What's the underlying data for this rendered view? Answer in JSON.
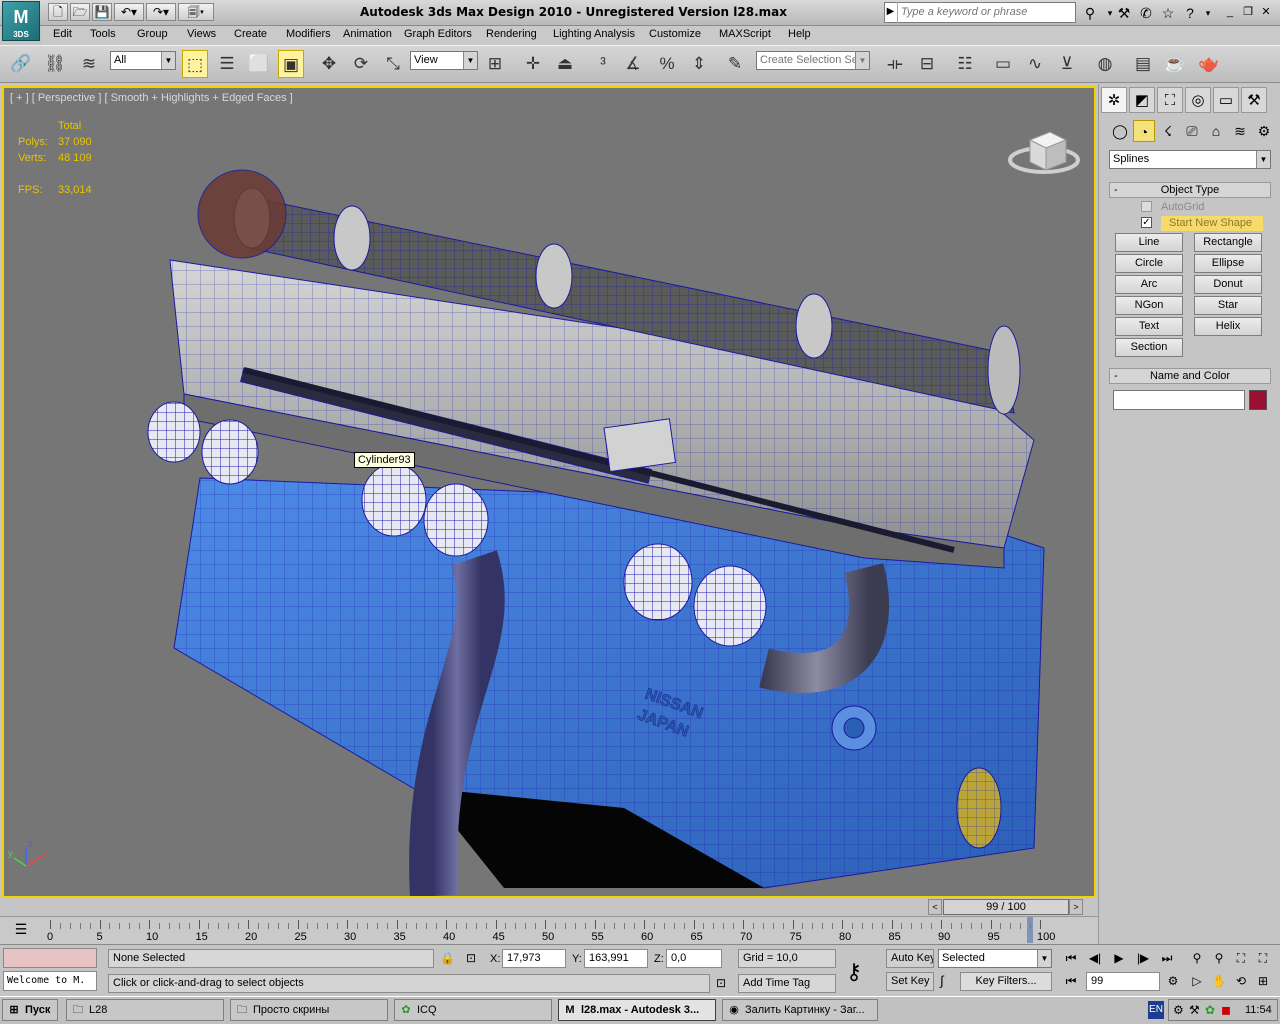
{
  "app": {
    "logo_text": "M",
    "logo_sub": "3DS",
    "title": "Autodesk 3ds Max Design 2010  -  Unregistered Version    l28.max"
  },
  "search": {
    "placeholder": "Type a keyword or phrase"
  },
  "menu": [
    "Edit",
    "Tools",
    "Group",
    "Views",
    "Create",
    "Modifiers",
    "Animation",
    "Graph Editors",
    "Rendering",
    "Lighting Analysis",
    "Customize",
    "MAXScript",
    "Help"
  ],
  "toolbar": {
    "selection_filter": "All",
    "ref_coord": "View",
    "named_selection_placeholder": "Create Selection Se"
  },
  "viewport": {
    "label": "[ + ] [ Perspective ] [ Smooth + Highlights + Edged Faces ]",
    "stats": {
      "total_label": "Total",
      "polys_label": "Polys:",
      "polys_value": "37 090",
      "verts_label": "Verts:",
      "verts_value": "48 109",
      "fps_label": "FPS:",
      "fps_value": "33,014"
    },
    "engraving": [
      "NISSAN",
      "JAPAN"
    ],
    "tooltip": "Cylinder93",
    "axis": {
      "x": "x",
      "y": "y",
      "z": "z"
    }
  },
  "command_panel": {
    "category": "Splines",
    "object_type_title": "Object Type",
    "autogrid_label": "AutoGrid",
    "start_new_shape_label": "Start New Shape",
    "start_new_shape_checked": true,
    "buttons": [
      "Line",
      "Rectangle",
      "Circle",
      "Ellipse",
      "Arc",
      "Donut",
      "NGon",
      "Star",
      "Text",
      "Helix",
      "Section"
    ],
    "name_color_title": "Name and Color",
    "object_name": "",
    "color": "#9a1030"
  },
  "timeline": {
    "slider_text": "99 / 100",
    "current_frame": 99,
    "frame_range": [
      0,
      100
    ],
    "ruler_labels": [
      "0",
      "5",
      "10",
      "15",
      "20",
      "25",
      "30",
      "35",
      "40",
      "45",
      "50",
      "55",
      "60",
      "65",
      "70",
      "75",
      "80",
      "85",
      "90",
      "95",
      "100"
    ]
  },
  "status": {
    "listener": "Welcome to M.",
    "selection": "None Selected",
    "prompt": "Click or click-and-drag to select objects",
    "x_label": "X:",
    "x_value": "17,973",
    "y_label": "Y:",
    "y_value": "163,991",
    "z_label": "Z:",
    "z_value": "0,0",
    "grid": "Grid = 10,0",
    "add_time_tag": "Add Time Tag",
    "auto_key": "Auto Key",
    "set_key": "Set Key",
    "key_mode": "Selected",
    "key_filters": "Key Filters...",
    "frame_field": "99"
  },
  "taskbar": {
    "start": "Пуск",
    "tasks": [
      "L28",
      "Просто скрины",
      "ICQ",
      "l28.max - Autodesk 3...",
      "Залить Картинку - Заг..."
    ],
    "lang": "EN",
    "clock": "11:54"
  },
  "colors": {
    "viewport_bg": "#767676",
    "active_border": "#f5d100",
    "stats": "#e7c400",
    "engine_blue": "#3d7bd9",
    "wire": "#1a1aa0"
  }
}
